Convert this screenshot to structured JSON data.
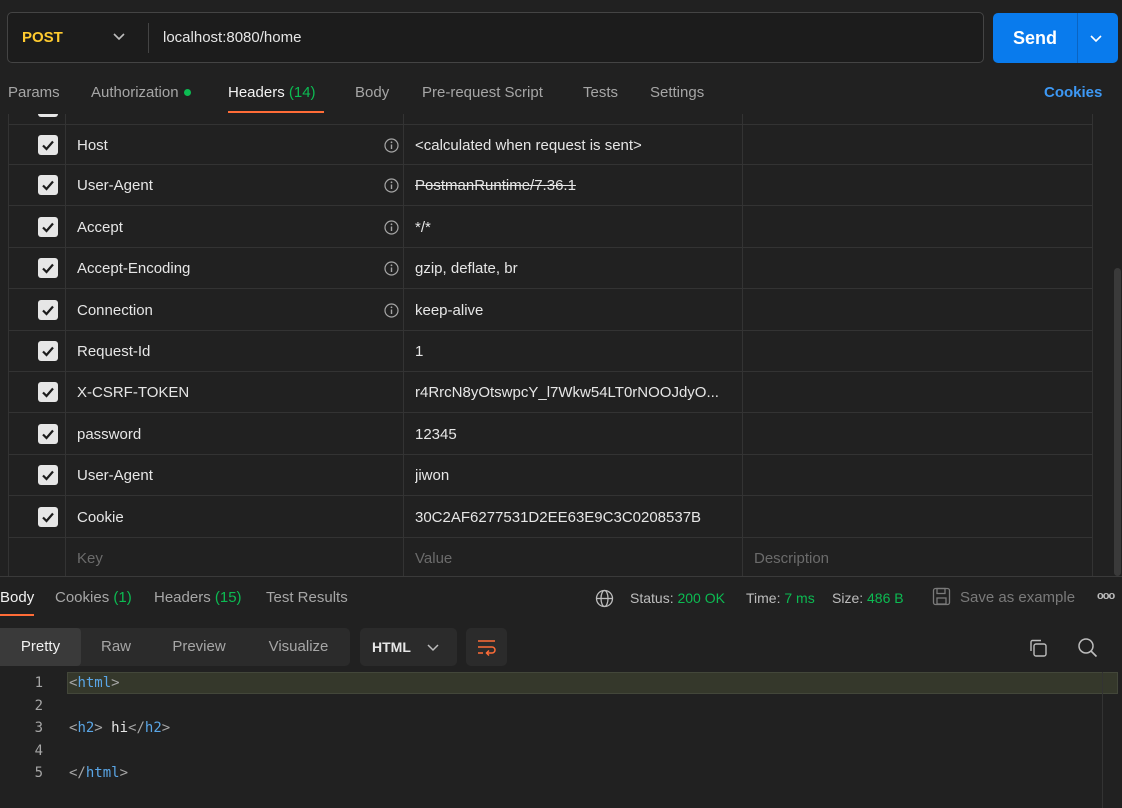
{
  "request": {
    "method": "POST",
    "url": "localhost:8080/home",
    "send_label": "Send"
  },
  "request_tabs": [
    {
      "label": "Params"
    },
    {
      "label": "Authorization"
    },
    {
      "label": "Headers",
      "count": "(14)"
    },
    {
      "label": "Body"
    },
    {
      "label": "Pre-request Script"
    },
    {
      "label": "Tests"
    },
    {
      "label": "Settings"
    }
  ],
  "cookies_link": "Cookies",
  "headers": [
    {
      "key": "Host",
      "value": "<calculated when request is sent>",
      "info": true,
      "struck": false
    },
    {
      "key": "User-Agent",
      "value": "PostmanRuntime/7.36.1",
      "info": true,
      "struck": true
    },
    {
      "key": "Accept",
      "value": "*/*",
      "info": true,
      "struck": false
    },
    {
      "key": "Accept-Encoding",
      "value": "gzip, deflate, br",
      "info": true,
      "struck": false
    },
    {
      "key": "Connection",
      "value": "keep-alive",
      "info": true,
      "struck": false
    },
    {
      "key": "Request-Id",
      "value": "1",
      "info": false,
      "struck": false
    },
    {
      "key": "X-CSRF-TOKEN",
      "value": "r4RrcN8yOtswpcY_l7Wkw54LT0rNOOJdyO...",
      "info": false,
      "struck": false
    },
    {
      "key": "password",
      "value": "12345",
      "info": false,
      "struck": false
    },
    {
      "key": "User-Agent",
      "value": "jiwon",
      "info": false,
      "struck": false
    },
    {
      "key": "Cookie",
      "value": "30C2AF6277531D2EE63E9C3C0208537B",
      "info": false,
      "struck": false
    }
  ],
  "new_row": {
    "key_placeholder": "Key",
    "value_placeholder": "Value",
    "description_placeholder": "Description"
  },
  "response_tabs": [
    {
      "label": "Body"
    },
    {
      "label": "Cookies",
      "count": "(1)"
    },
    {
      "label": "Headers",
      "count": "(15)"
    },
    {
      "label": "Test Results"
    }
  ],
  "status": {
    "status_label": "Status:",
    "status_value": "200 OK",
    "time_label": "Time:",
    "time_value": "7 ms",
    "size_label": "Size:",
    "size_value": "486 B",
    "save_label": "Save as example",
    "more": "ooo"
  },
  "view_modes": [
    {
      "label": "Pretty"
    },
    {
      "label": "Raw"
    },
    {
      "label": "Preview"
    },
    {
      "label": "Visualize"
    }
  ],
  "language": "HTML",
  "code_lines": [
    {
      "num": "1",
      "open": "<",
      "tag": "html",
      "close": ">",
      "text": ""
    },
    {
      "num": "2"
    },
    {
      "num": "3",
      "open": "<",
      "tag": "h2",
      "close": ">",
      "text": " hi",
      "open2": "</",
      "tag2": "h2",
      "close2": ">"
    },
    {
      "num": "4"
    },
    {
      "num": "5",
      "open": "</",
      "tag": "html",
      "close": ">",
      "text": ""
    }
  ],
  "colors": {
    "accent": "#ff6c37",
    "send": "#097bed",
    "method": "#ffcb2f",
    "green": "#0cbb52",
    "link": "#3d98f4"
  }
}
